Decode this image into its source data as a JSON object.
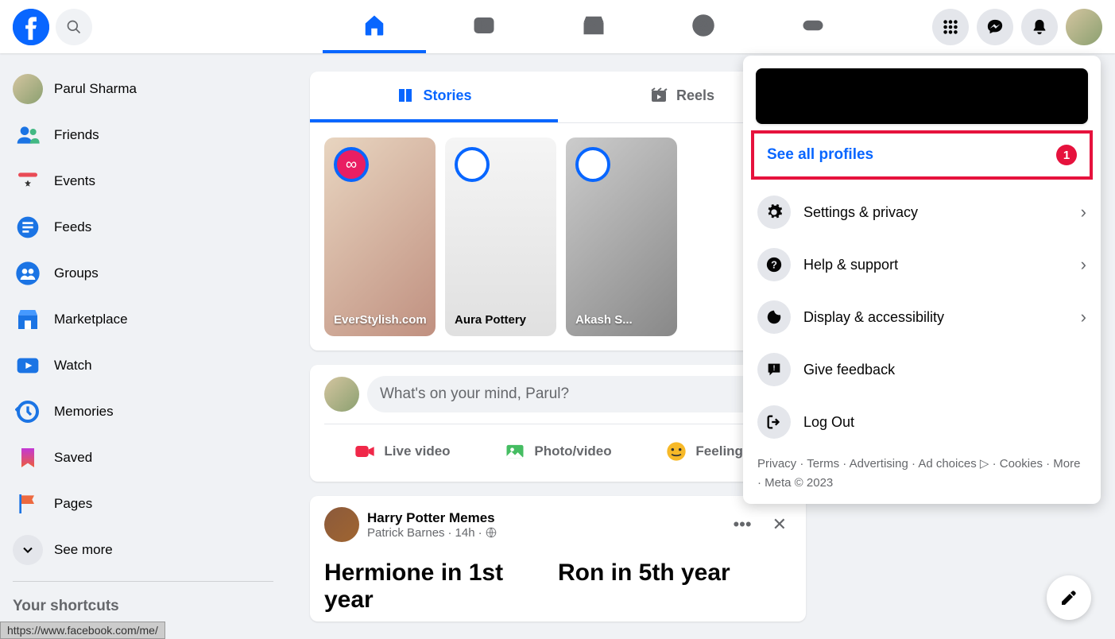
{
  "header": {
    "nav": [
      "home",
      "watch",
      "marketplace",
      "groups",
      "gaming"
    ],
    "right_icons": [
      "menu",
      "messenger",
      "notifications",
      "account"
    ]
  },
  "sidebar": {
    "user_name": "Parul Sharma",
    "items": [
      {
        "label": "Friends"
      },
      {
        "label": "Events"
      },
      {
        "label": "Feeds"
      },
      {
        "label": "Groups"
      },
      {
        "label": "Marketplace"
      },
      {
        "label": "Watch"
      },
      {
        "label": "Memories"
      },
      {
        "label": "Saved"
      },
      {
        "label": "Pages"
      }
    ],
    "see_more": "See more",
    "shortcuts_heading": "Your shortcuts"
  },
  "stories": {
    "tabs": {
      "stories": "Stories",
      "reels": "Reels"
    },
    "cards": [
      {
        "label": "EverStylish.com"
      },
      {
        "label": "Aura Pottery"
      },
      {
        "label": "Akash S..."
      }
    ]
  },
  "composer": {
    "placeholder": "What's on your mind, Parul?",
    "actions": {
      "live": "Live video",
      "photo": "Photo/video",
      "feeling": "Feeling/ac"
    }
  },
  "post": {
    "author": "Harry Potter Memes",
    "byline_name": "Patrick Barnes",
    "byline_time": "14h",
    "body_left": "Hermione in 1st year",
    "body_right": "Ron in 5th year"
  },
  "account_menu": {
    "see_profiles": "See all profiles",
    "badge": "1",
    "items": [
      {
        "label": "Settings & privacy",
        "chevron": true
      },
      {
        "label": "Help & support",
        "chevron": true
      },
      {
        "label": "Display & accessibility",
        "chevron": true
      },
      {
        "label": "Give feedback",
        "chevron": false
      },
      {
        "label": "Log Out",
        "chevron": false
      }
    ],
    "footer": {
      "privacy": "Privacy",
      "terms": "Terms",
      "advertising": "Advertising",
      "ad_choices": "Ad choices",
      "cookies": "Cookies",
      "more": "More",
      "meta": "Meta © 2023"
    }
  },
  "status_bar": "https://www.facebook.com/me/"
}
